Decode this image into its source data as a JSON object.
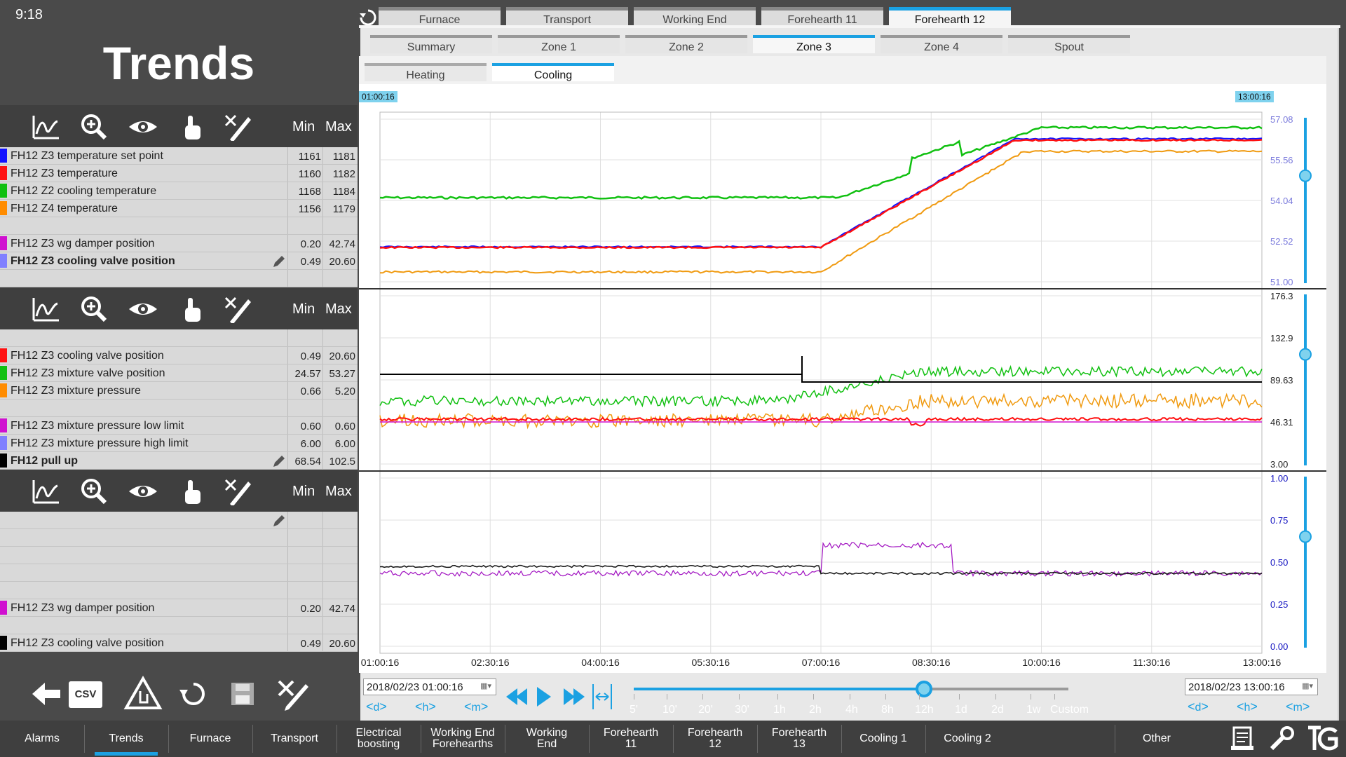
{
  "status": {
    "time": "9:18"
  },
  "page": {
    "title": "Trends"
  },
  "toolbar": {
    "min_label": "Min",
    "max_label": "Max"
  },
  "tabs": {
    "level1": [
      {
        "label": "Furnace",
        "active": false
      },
      {
        "label": "Transport",
        "active": false
      },
      {
        "label": "Working End",
        "active": false
      },
      {
        "label": "Forehearth 11",
        "active": false
      },
      {
        "label": "Forehearth 12",
        "active": true
      }
    ],
    "level2": [
      {
        "label": "Summary",
        "active": false
      },
      {
        "label": "Zone 1",
        "active": false
      },
      {
        "label": "Zone 2",
        "active": false
      },
      {
        "label": "Zone 3",
        "active": true
      },
      {
        "label": "Zone 4",
        "active": false
      },
      {
        "label": "Spout",
        "active": false
      }
    ],
    "level3": [
      {
        "label": "Heating",
        "active": false
      },
      {
        "label": "Cooling",
        "active": true
      }
    ]
  },
  "sections": [
    {
      "rows": [
        {
          "name": "FH12 Z3 temperature set point",
          "color": "#1010ff",
          "min": "1161",
          "max": "1181",
          "bold": false
        },
        {
          "name": "FH12 Z3 temperature",
          "color": "#ff1010",
          "min": "1160",
          "max": "1182",
          "bold": false
        },
        {
          "name": "FH12 Z2 cooling temperature",
          "color": "#10c010",
          "min": "1168",
          "max": "1184",
          "bold": false
        },
        {
          "name": "FH12 Z4 temperature",
          "color": "#ff8c00",
          "min": "1156",
          "max": "1179",
          "bold": false
        },
        {
          "name": "",
          "color": "",
          "min": "",
          "max": "",
          "bold": false
        },
        {
          "name": "FH12 Z3 wg damper position",
          "color": "#d010d0",
          "min": "0.20",
          "max": "42.74",
          "bold": false
        },
        {
          "name": "FH12 Z3 cooling valve position",
          "color": "#8080ff",
          "min": "0.49",
          "max": "20.60",
          "bold": true,
          "pen": true
        },
        {
          "name": "",
          "color": "",
          "min": "",
          "max": "",
          "bold": false
        }
      ]
    },
    {
      "rows": [
        {
          "name": "",
          "color": "",
          "min": "",
          "max": "",
          "bold": false
        },
        {
          "name": "FH12 Z3 cooling valve position",
          "color": "#ff1010",
          "min": "0.49",
          "max": "20.60",
          "bold": false
        },
        {
          "name": "FH12 Z3 mixture valve position",
          "color": "#10c010",
          "min": "24.57",
          "max": "53.27",
          "bold": false
        },
        {
          "name": "FH12 Z3 mixture pressure",
          "color": "#ff8c00",
          "min": "0.66",
          "max": "5.20",
          "bold": false
        },
        {
          "name": "",
          "color": "",
          "min": "",
          "max": "",
          "bold": false
        },
        {
          "name": "FH12 Z3 mixture pressure low limit",
          "color": "#d010d0",
          "min": "0.60",
          "max": "0.60",
          "bold": false
        },
        {
          "name": "FH12 Z3 mixture pressure high limit",
          "color": "#8080ff",
          "min": "6.00",
          "max": "6.00",
          "bold": false
        },
        {
          "name": "FH12 pull up",
          "color": "#000000",
          "min": "68.54",
          "max": "102.5",
          "bold": true,
          "pen": true
        }
      ]
    },
    {
      "rows": [
        {
          "name": "",
          "color": "",
          "min": "",
          "max": "",
          "bold": false,
          "pen": true
        },
        {
          "name": "",
          "color": "",
          "min": "",
          "max": "",
          "bold": false
        },
        {
          "name": "",
          "color": "",
          "min": "",
          "max": "",
          "bold": false
        },
        {
          "name": "",
          "color": "",
          "min": "",
          "max": "",
          "bold": false
        },
        {
          "name": "",
          "color": "",
          "min": "",
          "max": "",
          "bold": false
        },
        {
          "name": "FH12 Z3 wg damper position",
          "color": "#d010d0",
          "min": "0.20",
          "max": "42.74",
          "bold": false
        },
        {
          "name": "",
          "color": "",
          "min": "",
          "max": "",
          "bold": false
        },
        {
          "name": "FH12 Z3 cooling valve position",
          "color": "#000000",
          "min": "0.49",
          "max": "20.60",
          "bold": false
        }
      ]
    }
  ],
  "chart": {
    "start_label": "01:00:16",
    "end_label": "13:00:16",
    "x_ticks": [
      "01:00:16",
      "02:30:16",
      "04:00:16",
      "05:30:16",
      "07:00:16",
      "08:30:16",
      "10:00:16",
      "11:30:16",
      "13:00:16"
    ],
    "panels": [
      {
        "y_ticks": [
          "57.08",
          "55.56",
          "54.04",
          "52.52",
          "51.00"
        ],
        "tick_color": "#7a7adc"
      },
      {
        "y_ticks": [
          "176.3",
          "132.9",
          "89.63",
          "46.31",
          "3.00"
        ],
        "tick_color": "#222222"
      },
      {
        "y_ticks": [
          "1.00",
          "0.75",
          "0.50",
          "0.25",
          "0.00"
        ],
        "tick_color": "#1010c0"
      }
    ]
  },
  "controls": {
    "csv_label": "CSV",
    "start_datetime": "2018/02/23 01:00:16",
    "end_datetime": "2018/02/23 13:00:16",
    "nav_left": [
      "d",
      "h",
      "m"
    ],
    "nav_right": [
      "d",
      "h",
      "m"
    ],
    "ranges": [
      "5'",
      "10'",
      "20'",
      "30'",
      "1h",
      "2h",
      "4h",
      "8h",
      "12h",
      "1d",
      "2d",
      "1w",
      "Custom"
    ],
    "selected_range": "12h"
  },
  "bottom_nav": [
    {
      "label": "Alarms",
      "active": false
    },
    {
      "label": "Trends",
      "active": true
    },
    {
      "label": "Furnace",
      "active": false
    },
    {
      "label": "Transport",
      "active": false
    },
    {
      "label": "Electrical\nboosting",
      "active": false
    },
    {
      "label": "Working End\nForehearths",
      "active": false
    },
    {
      "label": "Working\nEnd",
      "active": false
    },
    {
      "label": "Forehearth\n11",
      "active": false
    },
    {
      "label": "Forehearth\n12",
      "active": false
    },
    {
      "label": "Forehearth\n13",
      "active": false
    },
    {
      "label": "Cooling 1",
      "active": false
    },
    {
      "label": "Cooling 2",
      "active": false
    },
    {
      "label": "Other",
      "active": false
    }
  ],
  "colors": {
    "accent": "#1ba1e2",
    "panel": "#3f3f3f",
    "background": "#4a4a4a"
  }
}
